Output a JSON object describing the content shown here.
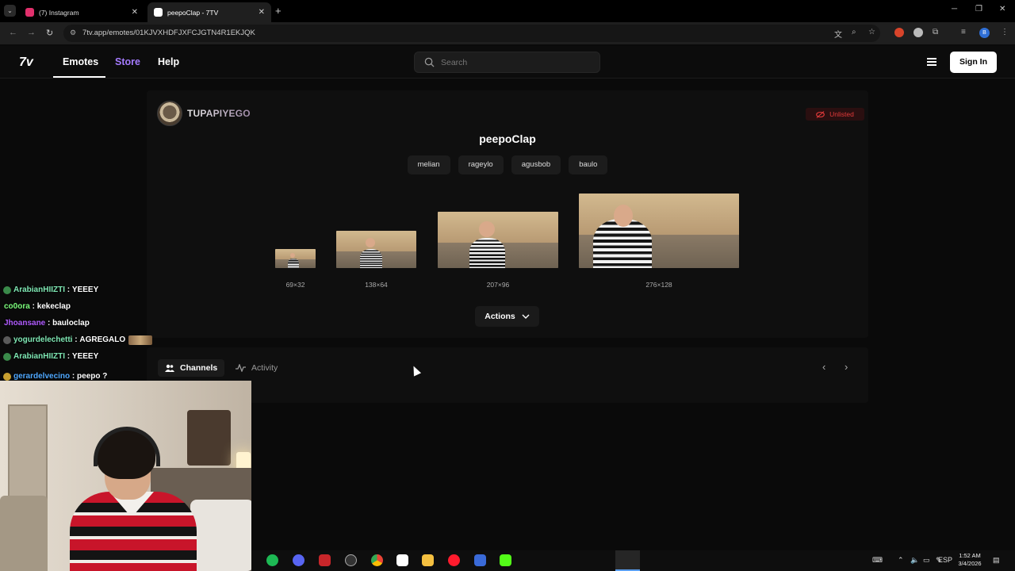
{
  "browser": {
    "tabs": [
      {
        "title": "(7) Instagram",
        "active": false,
        "favicon_color": "#e1306c"
      },
      {
        "title": "peepoClap - 7TV",
        "active": true,
        "favicon_color": "#ffffff"
      }
    ],
    "url": "7tv.app/emotes/01KJVXHDFJXFCJGTN4R1EKJQK",
    "profile_initial": "B"
  },
  "site": {
    "logo": "7v",
    "nav": [
      {
        "label": "Emotes",
        "active": true
      },
      {
        "label": "Store",
        "accent": "#a57bff"
      },
      {
        "label": "Help"
      }
    ],
    "search_placeholder": "Search",
    "signin_label": "Sign In"
  },
  "emote": {
    "owner": "TUPAPIYEGO",
    "visibility": "Unlisted",
    "name": "peepoClap",
    "tags": [
      "melian",
      "rageylo",
      "agusbob",
      "baulo"
    ],
    "sizes": [
      "69×32",
      "138×64",
      "207×96",
      "276×128"
    ],
    "actions_label": "Actions"
  },
  "panel": {
    "tabs": [
      "Channels",
      "Activity"
    ]
  },
  "chat": [
    {
      "user": "ArabianHIIZTI",
      "color": "#7fe8b4",
      "message": "YEEEY",
      "badge": "#3a8a4a"
    },
    {
      "user": "co0ora",
      "color": "#7cfc7c",
      "message": "kekeclap",
      "badge": ""
    },
    {
      "user": "Jhoansane",
      "color": "#b15cff",
      "message": "bauloclap",
      "badge": ""
    },
    {
      "user": "yogurdelechetti",
      "color": "#7fe8b4",
      "message": "AGREGALO",
      "badge": "#5a5a5a",
      "emote": true
    },
    {
      "user": "ArabianHIIZTI",
      "color": "#7fe8b4",
      "message": "YEEEY",
      "badge": "#3a8a4a"
    },
    {
      "user": "gerardelvecino",
      "color": "#4fa8ff",
      "message": "peepo ?",
      "badge": "#c9a030"
    }
  ],
  "system": {
    "language": "ESP",
    "time": "1:52 AM",
    "date": "3/4/2026"
  }
}
